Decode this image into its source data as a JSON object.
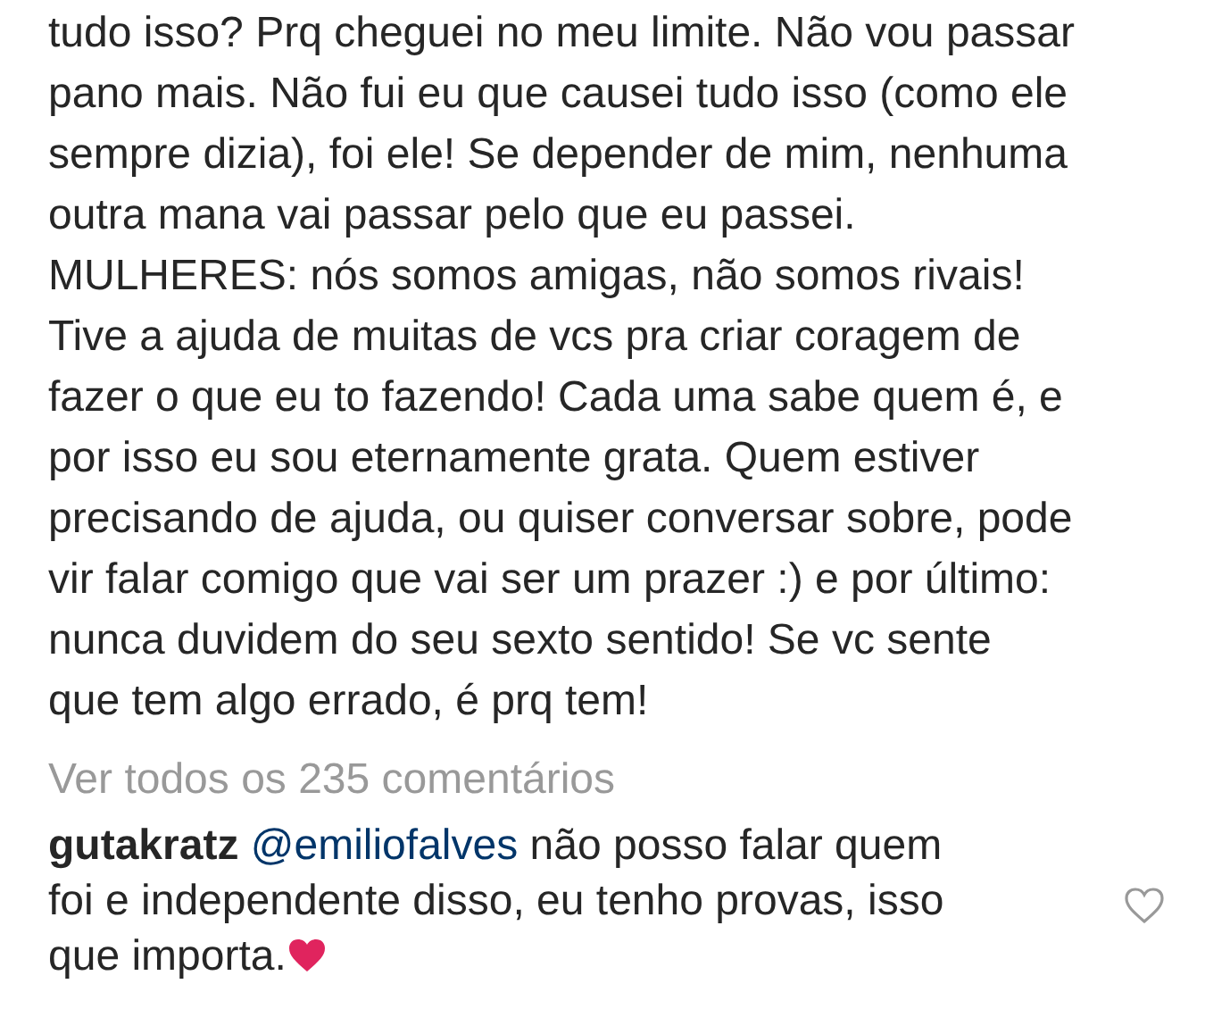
{
  "caption": {
    "lines": [
      "tudo isso? Prq cheguei no meu limite. Não vou passar",
      "pano mais. Não fui eu que causei tudo isso (como ele",
      "sempre dizia), foi ele! Se depender de mim, nenhuma",
      "outra mana vai passar pelo que eu passei.",
      "MULHERES: nós somos amigas, não somos rivais!",
      "Tive a ajuda de muitas de vcs pra criar coragem de",
      "fazer o que eu to fazendo! Cada uma sabe quem é, e",
      "por isso eu sou eternamente grata. Quem estiver",
      "precisando de ajuda, ou quiser conversar sobre, pode",
      "vir falar comigo que vai ser um prazer :) e por último:",
      "nunca duvidem do seu sexto sentido! Se vc sente",
      "que tem algo errado, é prq tem!"
    ]
  },
  "view_all_comments": "Ver todos os 235 comentários",
  "comment": {
    "username": "gutakratz",
    "mention": "@emiliofalves",
    "lines": [
      "não posso falar quem",
      "foi e independente disso, eu tenho provas, isso",
      "que importa."
    ],
    "liked": false
  }
}
